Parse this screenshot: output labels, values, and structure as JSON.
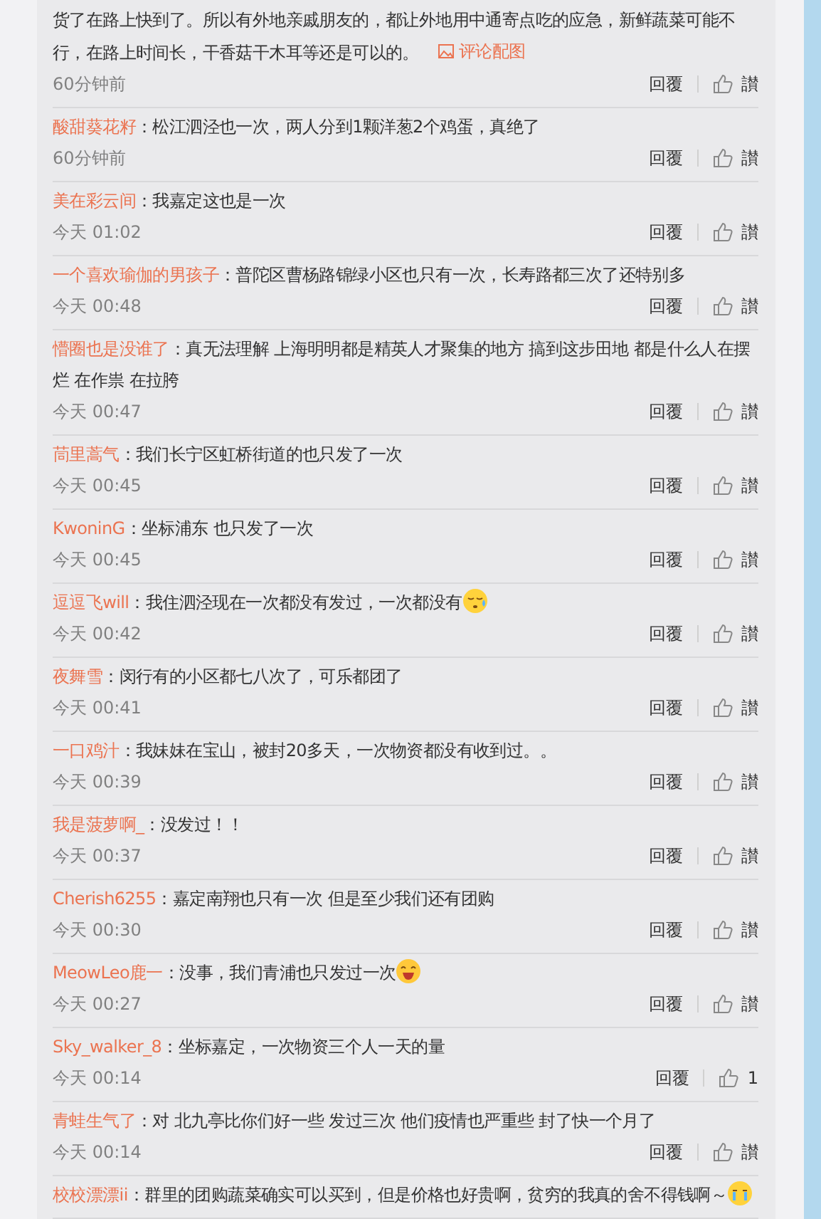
{
  "comments": [
    {
      "text": "货了在路上快到了。所以有外地亲戚朋友的，都让外地用中通寄点吃的应急，新鲜蔬菜可能不行，在路上时间长，干香菇干木耳等还是可以的。",
      "link": "评论配图",
      "time": "60分钟前",
      "reply": "回覆",
      "like": "讃"
    },
    {
      "author": "酸甜葵花籽",
      "sep": "：",
      "text": "松江泗泾也一次，两人分到1颗洋葱2个鸡蛋，真绝了",
      "time": "60分钟前",
      "reply": "回覆",
      "like": "讃"
    },
    {
      "author": "美在彩云间",
      "sep": "：",
      "text": "我嘉定这也是一次",
      "time": "今天 01:02",
      "reply": "回覆",
      "like": "讃"
    },
    {
      "author": "一个喜欢瑜伽的男孩子",
      "sep": "：",
      "text": "普陀区曹杨路锦绿小区也只有一次，长寿路都三次了还特别多",
      "time": "今天 00:48",
      "reply": "回覆",
      "like": "讃"
    },
    {
      "author": "懵圈也是没谁了",
      "sep": "：",
      "text": "真无法理解 上海明明都是精英人才聚集的地方 搞到这步田地 都是什么人在摆烂 在作祟 在拉胯",
      "time": "今天 00:47",
      "reply": "回覆",
      "like": "讃"
    },
    {
      "author": "茼里蒿气",
      "sep": "：",
      "text": "我们长宁区虹桥街道的也只发了一次",
      "time": "今天 00:45",
      "reply": "回覆",
      "like": "讃"
    },
    {
      "author": "KwoninG",
      "sep": "：",
      "text": "坐标浦东 也只发了一次",
      "time": "今天 00:45",
      "reply": "回覆",
      "like": "讃"
    },
    {
      "author": "逗逗飞will",
      "sep": "：",
      "text": "我住泗泾现在一次都没有发过，一次都没有",
      "emoji": {
        "kind": "sweat"
      },
      "time": "今天 00:42",
      "reply": "回覆",
      "like": "讃"
    },
    {
      "author": "夜舞雪",
      "sep": "：",
      "text": "闵行有的小区都七八次了，可乐都团了",
      "time": "今天 00:41",
      "reply": "回覆",
      "like": "讃"
    },
    {
      "author": "一口鸡汁",
      "sep": "：",
      "text": "我妹妹在宝山，被封20多天，一次物资都没有收到过。。",
      "time": "今天 00:39",
      "reply": "回覆",
      "like": "讃"
    },
    {
      "author": "我是菠萝啊_",
      "sep": "：",
      "text": "没发过！！",
      "time": "今天 00:37",
      "reply": "回覆",
      "like": "讃"
    },
    {
      "author": "Cherish6255",
      "sep": "：",
      "text": "嘉定南翔也只有一次 但是至少我们还有团购",
      "time": "今天 00:30",
      "reply": "回覆",
      "like": "讃"
    },
    {
      "author": "MeowLeo鹿一",
      "sep": "：",
      "text": "没事，我们青浦也只发过一次",
      "emoji": {
        "kind": "grin"
      },
      "time": "今天 00:27",
      "reply": "回覆",
      "like": "讃"
    },
    {
      "author": "Sky_walker_8",
      "sep": "：",
      "text": "坐标嘉定，一次物资三个人一天的量",
      "time": "今天 00:14",
      "reply": "回覆",
      "like": "1"
    },
    {
      "author": "青蛙生气了",
      "sep": "：",
      "text": "对 北九亭比你们好一些 发过三次 他们疫情也严重些 封了快一个月了",
      "time": "今天 00:14",
      "reply": "回覆",
      "like": "讃"
    },
    {
      "author": "校校漂漂ii",
      "sep": "：",
      "text": "群里的团购蔬菜确实可以买到，但是价格也好贵啊，贫穷的我真的舍不得钱啊～",
      "emoji": {
        "kind": "cry"
      }
    }
  ]
}
